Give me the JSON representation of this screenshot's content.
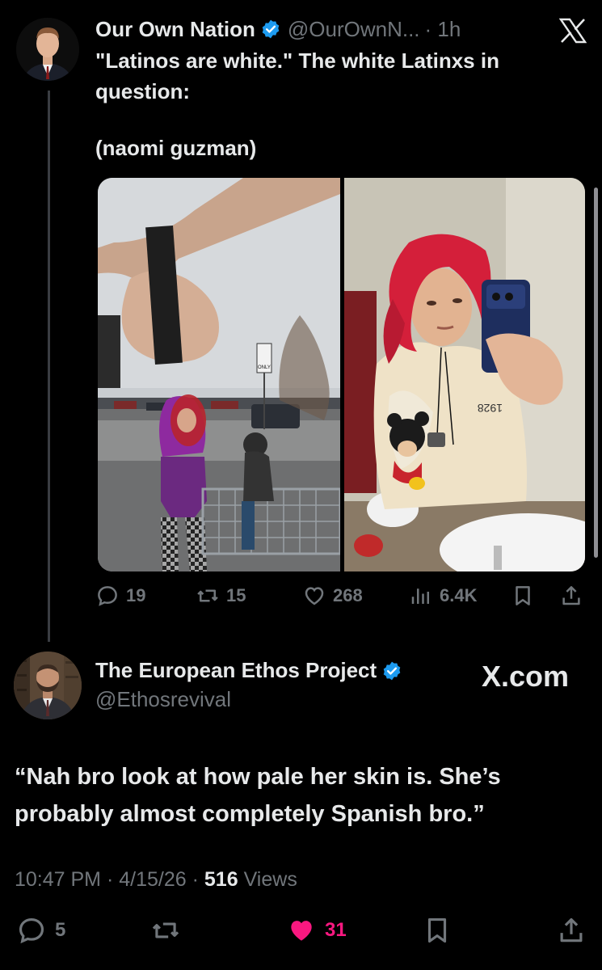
{
  "tweet1": {
    "author_name": "Our Own Nation",
    "handle": "@OurOwnN...",
    "time": "· 1h",
    "text": "\"Latinos are white.\" The white Latinxs in question:",
    "subtext": "(naomi guzman)",
    "stats": {
      "replies": "19",
      "reposts": "15",
      "likes": "268",
      "views": "6.4K"
    }
  },
  "tweet2": {
    "author_name": "The European Ethos Project",
    "handle": "@Ethosrevival",
    "text": "“Nah bro look at how pale her skin is. She’s probably almost completely Spanish bro.”",
    "time": "10:47 PM",
    "date": "4/15/26",
    "views": "516",
    "views_label": "Views",
    "stats": {
      "replies": "5",
      "likes": "31"
    }
  },
  "watermark": "X.com",
  "photo_sign_text": "ONLY",
  "hoodie_text": "1928",
  "colors": {
    "background": "#000000",
    "text": "#e7e9ea",
    "muted": "#71767b",
    "verified": "#1d9bf0",
    "like_active": "#f91880"
  },
  "icons": [
    "x-logo-icon",
    "verified-badge-icon",
    "reply-icon",
    "repost-icon",
    "like-icon",
    "views-icon",
    "bookmark-icon",
    "share-icon"
  ]
}
